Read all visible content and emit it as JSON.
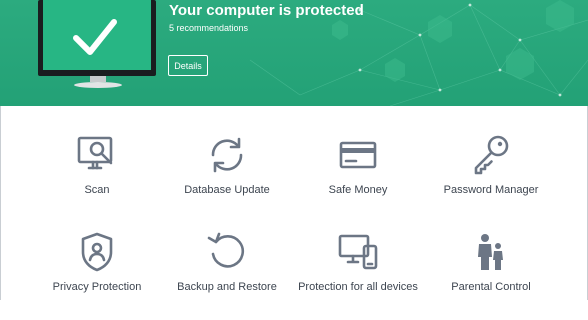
{
  "status": {
    "title": "Your computer is protected",
    "subtitle": "5 recommendations",
    "details_label": "Details",
    "banner_color": "#24a478"
  },
  "tiles": [
    {
      "label": "Scan",
      "icon": "scan-monitor-magnifier-icon"
    },
    {
      "label": "Database Update",
      "icon": "refresh-arrows-icon"
    },
    {
      "label": "Safe Money",
      "icon": "credit-card-icon"
    },
    {
      "label": "Password Manager",
      "icon": "key-icon"
    },
    {
      "label": "Privacy Protection",
      "icon": "shield-user-icon"
    },
    {
      "label": "Backup and Restore",
      "icon": "restore-arrow-icon"
    },
    {
      "label": "Protection for all devices",
      "icon": "monitor-phone-icon"
    },
    {
      "label": "Parental Control",
      "icon": "family-icon"
    }
  ],
  "colors": {
    "icon": "#6c7685",
    "text": "#3d4550"
  }
}
